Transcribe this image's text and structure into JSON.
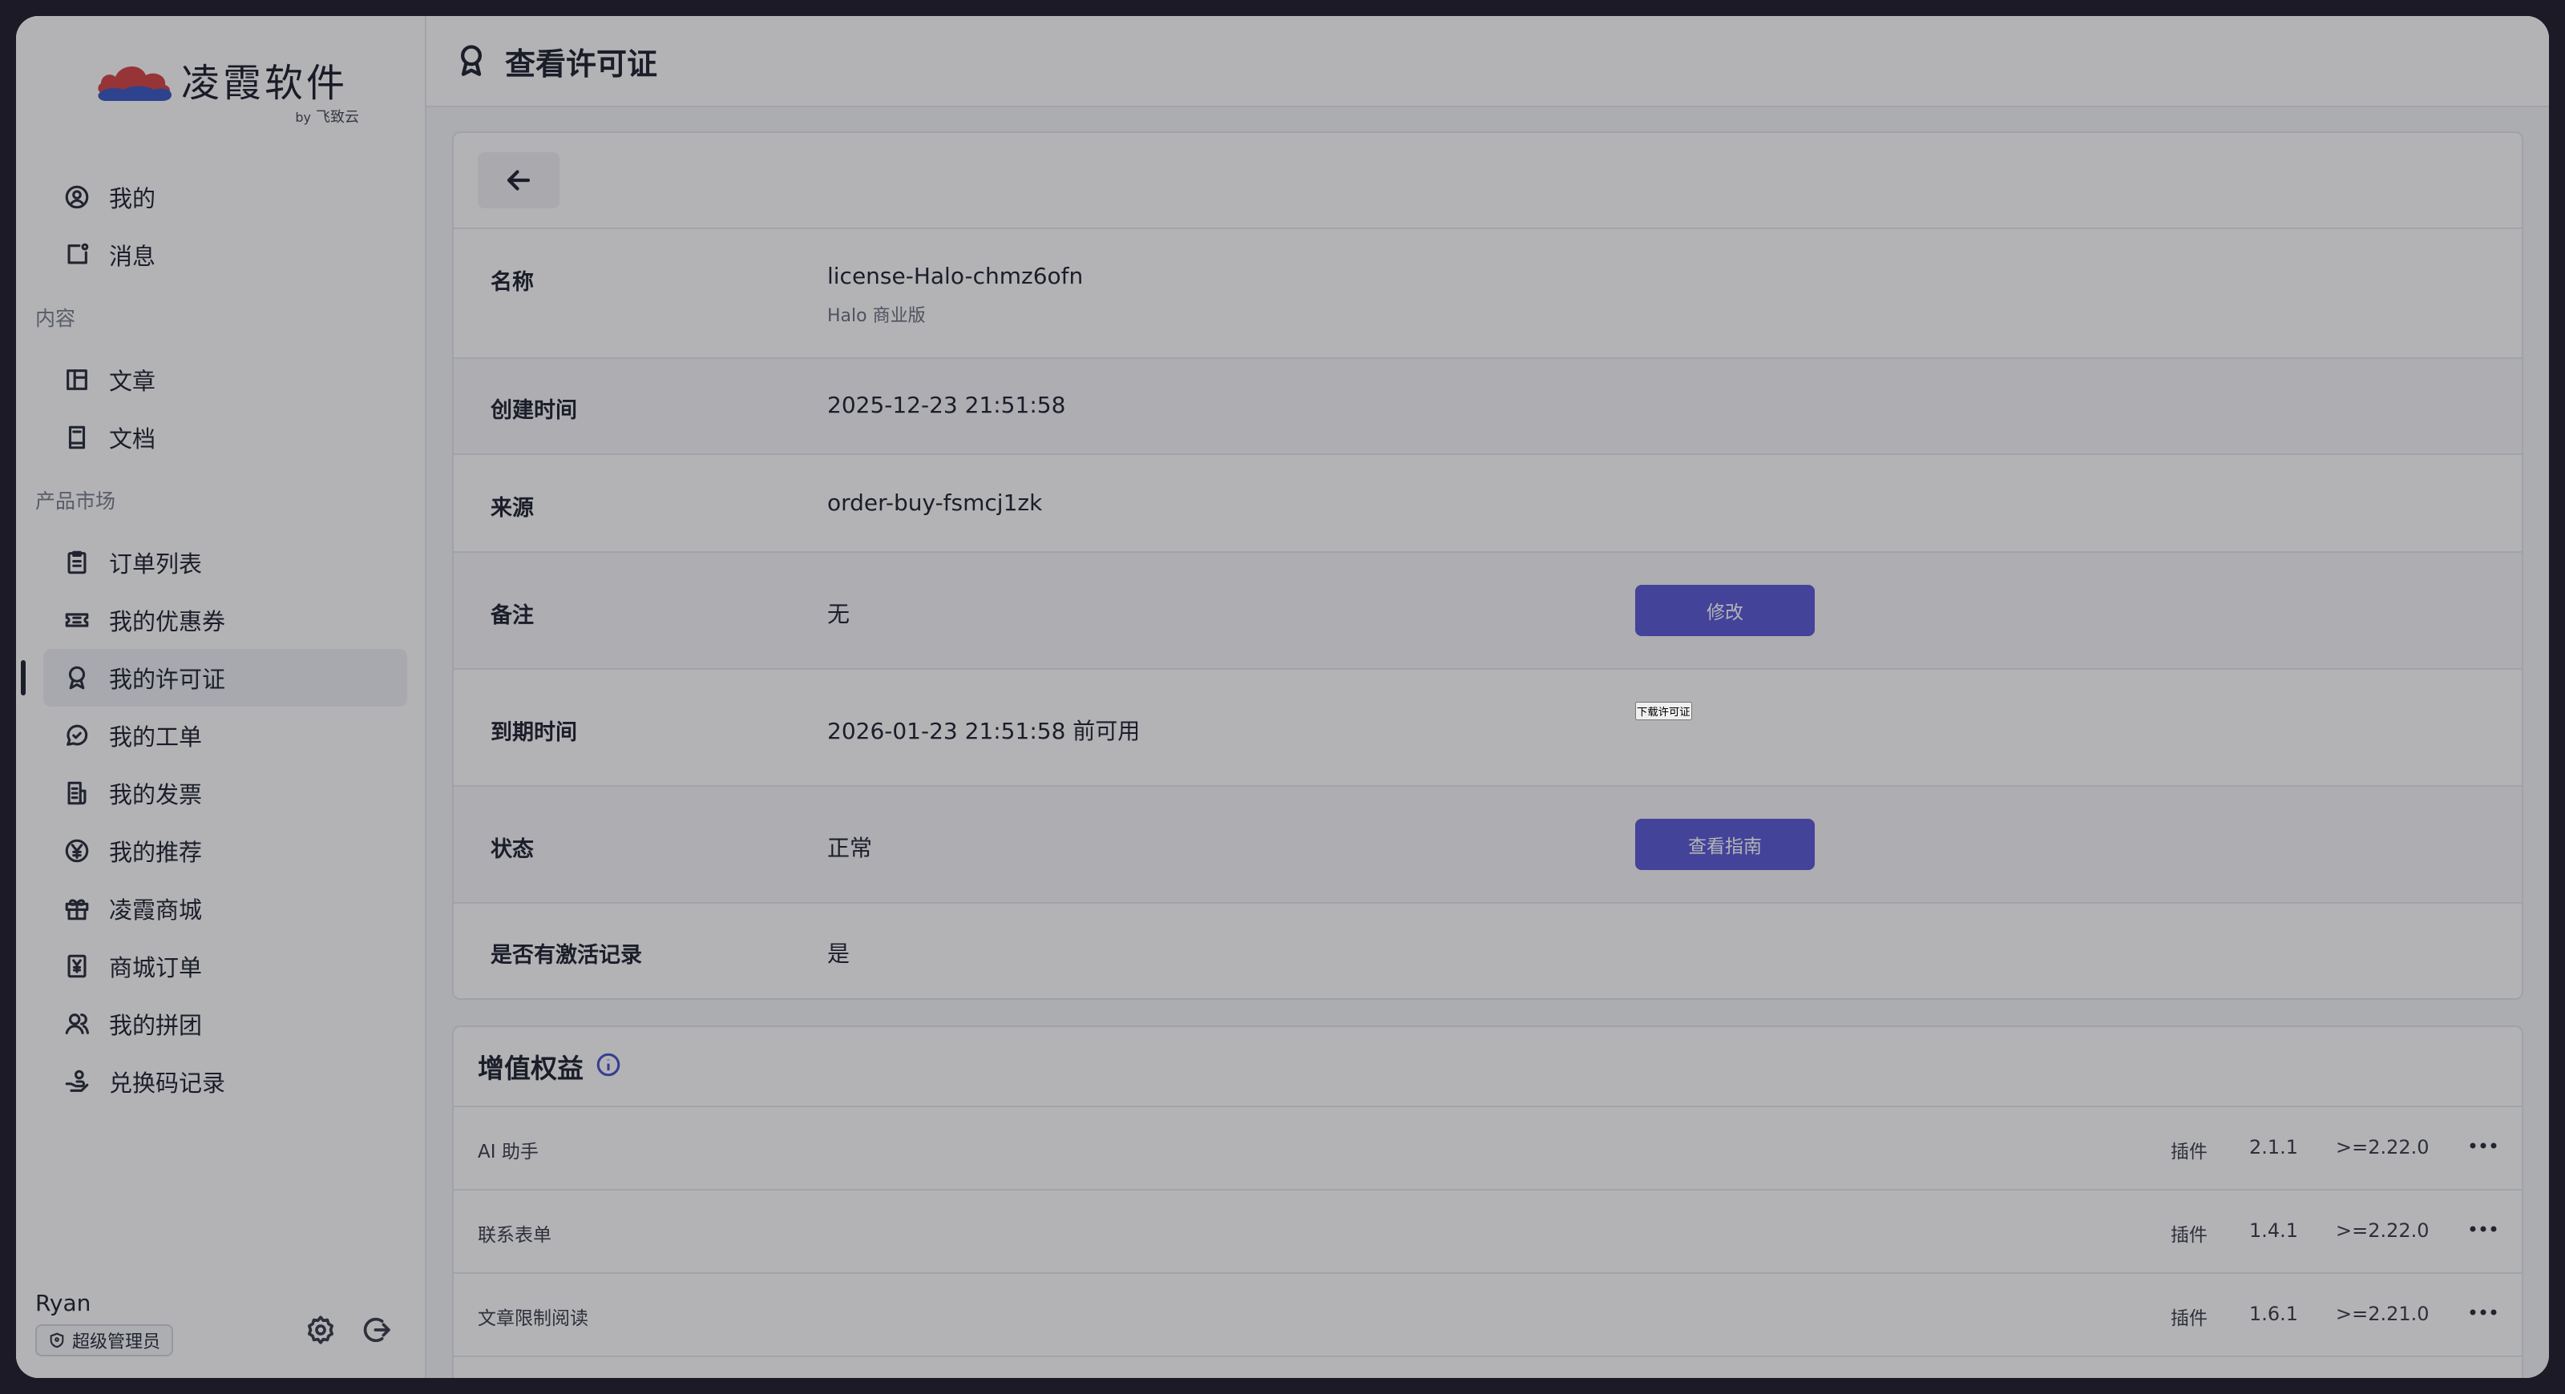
{
  "brand": {
    "name": "凌霞软件",
    "by": "by",
    "by_name": "飞致云"
  },
  "sidebar": {
    "items_top": [
      {
        "label": "我的",
        "icon": "user-circle-icon"
      },
      {
        "label": "消息",
        "icon": "message-icon"
      }
    ],
    "group_content": "内容",
    "items_content": [
      {
        "label": "文章",
        "icon": "article-icon"
      },
      {
        "label": "文档",
        "icon": "book-icon"
      }
    ],
    "group_market": "产品市场",
    "items_market": [
      {
        "label": "订单列表",
        "icon": "clipboard-icon"
      },
      {
        "label": "我的优惠券",
        "icon": "coupon-icon"
      },
      {
        "label": "我的许可证",
        "icon": "award-icon",
        "active": true
      },
      {
        "label": "我的工单",
        "icon": "chat-icon"
      },
      {
        "label": "我的发票",
        "icon": "invoice-icon"
      },
      {
        "label": "我的推荐",
        "icon": "yen-icon"
      },
      {
        "label": "凌霞商城",
        "icon": "gift-icon"
      },
      {
        "label": "商城订单",
        "icon": "receipt-icon"
      },
      {
        "label": "我的拼团",
        "icon": "group-icon"
      },
      {
        "label": "兑换码记录",
        "icon": "redeem-icon"
      }
    ]
  },
  "user": {
    "name": "Ryan",
    "role": "超级管理员"
  },
  "header": {
    "title": "查看许可证"
  },
  "license": {
    "rows": [
      {
        "key": "名称",
        "value": "license-Halo-chmz6ofn",
        "sub": "Halo 商业版"
      },
      {
        "key": "创建时间",
        "value": "2025-12-23 21:51:58"
      },
      {
        "key": "来源",
        "value": "order-buy-fsmcj1zk"
      },
      {
        "key": "备注",
        "value": "无",
        "button": "修改"
      },
      {
        "key": "到期时间",
        "value": "2026-01-23 21:51:58 前可用",
        "button": "下载许可证"
      },
      {
        "key": "状态",
        "value": "正常",
        "button": "查看指南"
      },
      {
        "key": "是否有激活记录",
        "value": "是"
      }
    ]
  },
  "benefits": {
    "title": "增值权益",
    "items": [
      {
        "name": "AI 助手",
        "type": "插件",
        "version": "2.1.1",
        "requires": ">=2.22.0"
      },
      {
        "name": "联系表单",
        "type": "插件",
        "version": "1.4.1",
        "requires": ">=2.22.0"
      },
      {
        "name": "文章限制阅读",
        "type": "插件",
        "version": "1.6.1",
        "requires": ">=2.21.0"
      }
    ]
  },
  "colors": {
    "accent": "#5b5bd6",
    "sidebar_bg": "#ffffff",
    "page_bg": "#f5f6f8"
  }
}
